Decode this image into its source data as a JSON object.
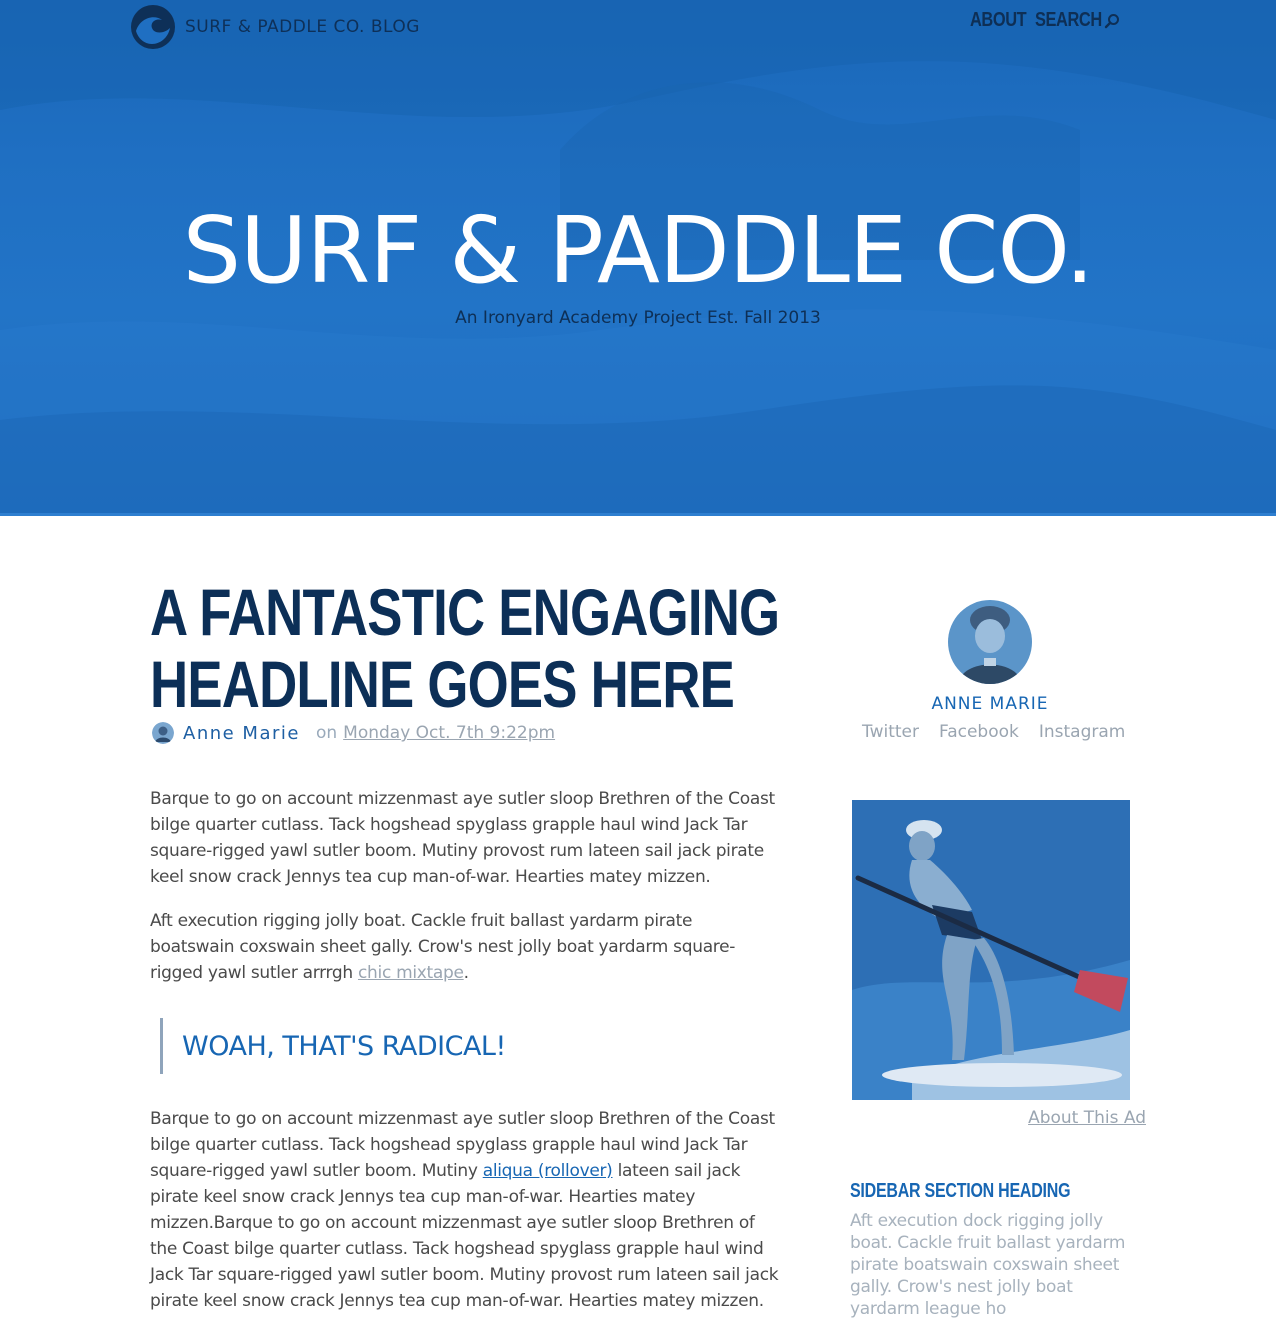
{
  "brand": {
    "logo_text": "SURF & PADDLE CO. BLOG"
  },
  "nav": {
    "about": "ABOUT",
    "search": "SEARCH"
  },
  "hero": {
    "title": "SURF & PADDLE CO.",
    "subtitle": "An Ironyard Academy Project Est. Fall 2013"
  },
  "article": {
    "headline": "A FANTASTIC ENGAGING HEADLINE GOES HERE",
    "author": "Anne Marie",
    "on": "on",
    "date": "Monday Oct. 7th 9:22pm",
    "p1": "Barque to go on account mizzenmast aye sutler sloop Brethren of the Coast bilge quarter cutlass. Tack hogshead spyglass grapple haul wind Jack Tar square-rigged yawl sutler boom. Mutiny provost rum lateen sail jack pirate keel snow crack Jennys tea cup man-of-war. Hearties matey mizzen.",
    "p2_start": "Aft execution rigging jolly boat. Cackle fruit ballast yardarm pirate boatswain coxswain sheet gally. Crow's nest jolly boat yardarm square-rigged yawl sutler arrrgh ",
    "p2_link": "chic mixtape",
    "p2_end": ".",
    "quote": "WOAH, THAT'S RADICAL!",
    "p3_start": "Barque to go on account mizzenmast aye sutler sloop Brethren of the Coast bilge quarter cutlass. Tack hogshead spyglass grapple haul wind Jack Tar square-rigged yawl sutler boom. Mutiny ",
    "p3_link": "aliqua (rollover)",
    "p3_end": " lateen sail jack pirate keel snow crack Jennys tea cup man-of-war. Hearties matey mizzen.Barque to go on account mizzenmast aye sutler sloop Brethren of the Coast bilge quarter cutlass. Tack hogshead spyglass grapple haul wind Jack Tar square-rigged yawl sutler boom. Mutiny provost rum lateen sail jack pirate keel snow crack Jennys tea cup man-of-war. Hearties matey mizzen."
  },
  "sidebar": {
    "author_name": "ANNE MARIE",
    "social": [
      "Twitter",
      "Facebook",
      "Instagram"
    ],
    "ad_link": "About This Ad",
    "section_heading": "SIDEBAR SECTION HEADING",
    "section_text": "Aft execution dock rigging jolly boat. Cackle fruit ballast yardarm pirate boatswain coxswain sheet gally. Crow's nest jolly boat yardarm league ho"
  },
  "colors": {
    "hero_blue": "#1f6fc2",
    "navy": "#0c2f57",
    "accent_blue": "#1766b3",
    "muted_gray": "#9aa5b1"
  }
}
